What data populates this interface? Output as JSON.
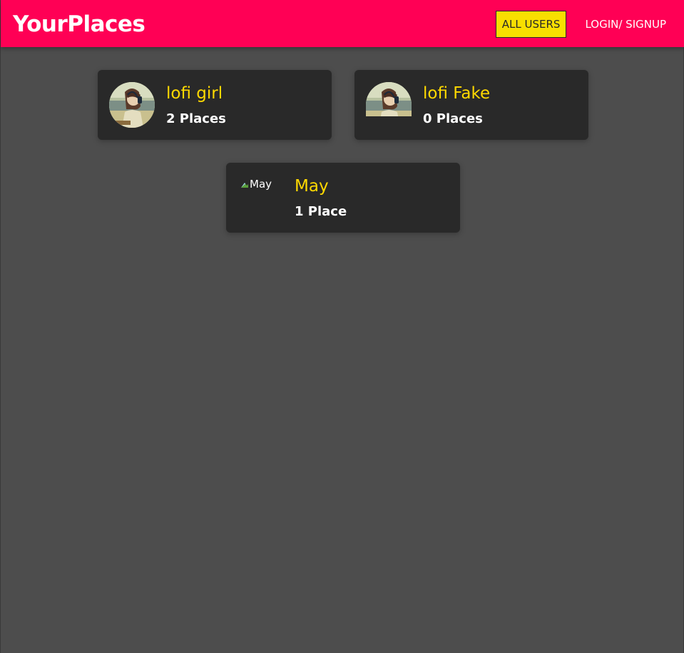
{
  "app": {
    "logo": "YourPlaces"
  },
  "nav": {
    "items": [
      {
        "label": "ALL USERS",
        "active": true
      },
      {
        "label": "LOGIN/ SIGNUP",
        "active": false
      }
    ]
  },
  "users": [
    {
      "name": "lofi girl",
      "places": "2 Places",
      "avatar": "lofi-girl-image"
    },
    {
      "name": "lofi Fake",
      "places": "0 Places",
      "avatar": "lofi-girl-image"
    },
    {
      "name": "May",
      "places": "1 Place",
      "avatar": "broken-image",
      "avatar_alt": "May"
    }
  ],
  "colors": {
    "header": "#ff0055",
    "background": "#4d4d4d",
    "card": "#292929",
    "accent_yellow": "#ffd900",
    "active_nav": "#f8df00"
  }
}
